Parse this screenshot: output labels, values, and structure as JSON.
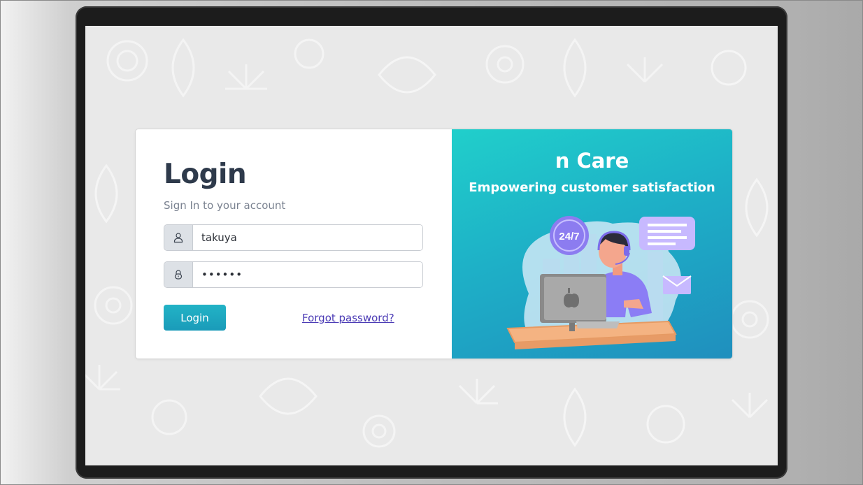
{
  "login": {
    "title": "Login",
    "subtitle": "Sign In to your account",
    "username_value": "takuya",
    "password_value": "••••••",
    "login_button": "Login",
    "forgot_link": "Forgot password?"
  },
  "brand": {
    "title": "n Care",
    "tagline": "Empowering customer satisfaction",
    "badge_text": "24/7"
  },
  "icons": {
    "user": "user-icon",
    "lock": "lock-icon",
    "mail": "mail-icon",
    "chat": "chat-bubble-icon"
  },
  "colors": {
    "title": "#2e3a4b",
    "button": "#1fa9c1",
    "link": "#4b3bb5",
    "brand_gradient_start": "#20cfcb",
    "brand_gradient_end": "#1f8fbe"
  }
}
